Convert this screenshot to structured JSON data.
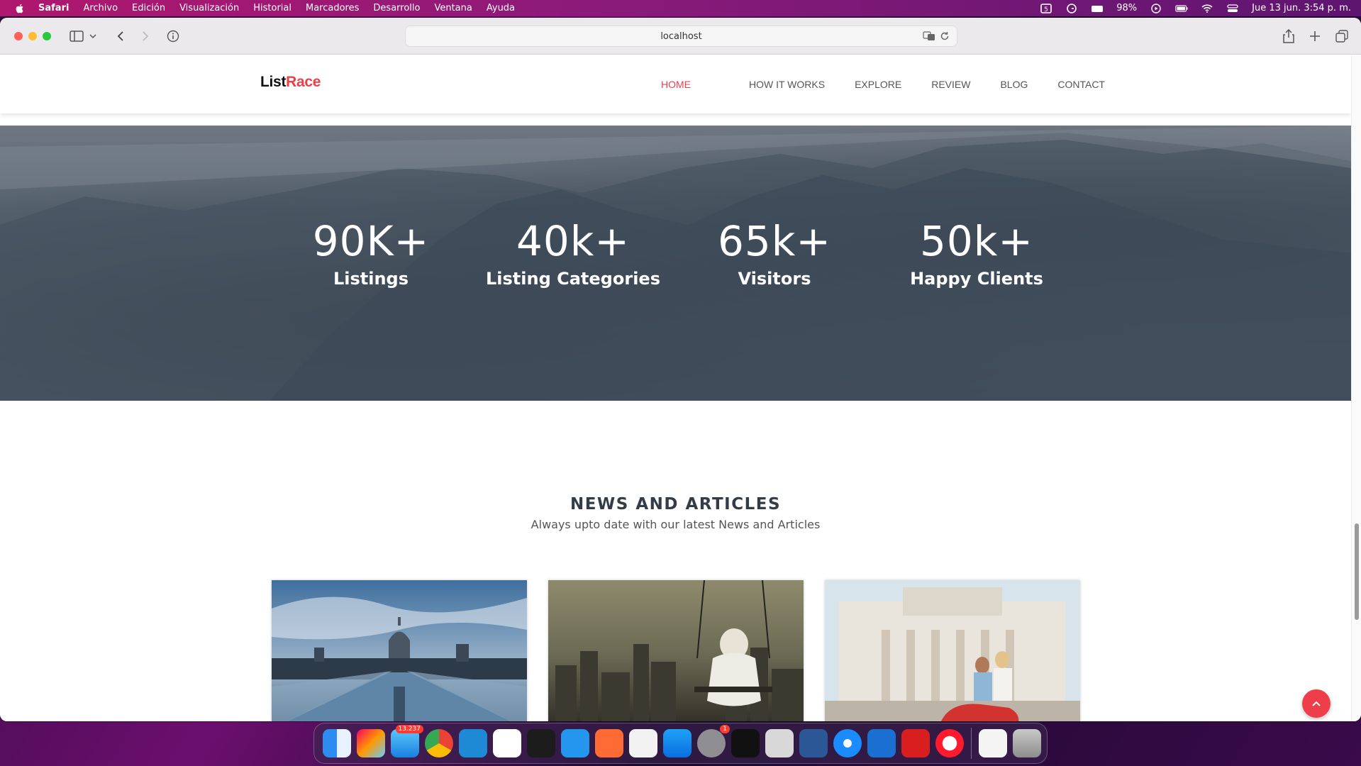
{
  "menubar": {
    "app_name": "Safari",
    "items": [
      "Archivo",
      "Edición",
      "Visualización",
      "Historial",
      "Marcadores",
      "Desarrollo",
      "Ventana",
      "Ayuda"
    ],
    "battery": "98%",
    "datetime": "Jue 13 jun.  3:54 p. m."
  },
  "browser": {
    "url": "localhost"
  },
  "site": {
    "logo_part1": "List",
    "logo_part2": "Race",
    "nav": [
      {
        "label": "HOME",
        "active": true
      },
      {
        "label": "HOW IT WORKS",
        "active": false
      },
      {
        "label": "EXPLORE",
        "active": false
      },
      {
        "label": "REVIEW",
        "active": false
      },
      {
        "label": "BLOG",
        "active": false
      },
      {
        "label": "CONTACT",
        "active": false
      }
    ],
    "stats": [
      {
        "value": "90K+",
        "label": "Listings"
      },
      {
        "value": "40k+",
        "label": "Listing Categories"
      },
      {
        "value": "65k+",
        "label": "Visitors"
      },
      {
        "value": "50k+",
        "label": "Happy Clients"
      }
    ],
    "news": {
      "title": "NEWS AND ARTICLES",
      "subtitle": "Always upto date with our latest News and Articles"
    }
  },
  "dock": {
    "mail_badge": "13.237",
    "settings_badge": "1"
  },
  "colors": {
    "accent": "#ee3e4a",
    "menubar_start": "#b0176e",
    "menubar_end": "#5e1570"
  }
}
